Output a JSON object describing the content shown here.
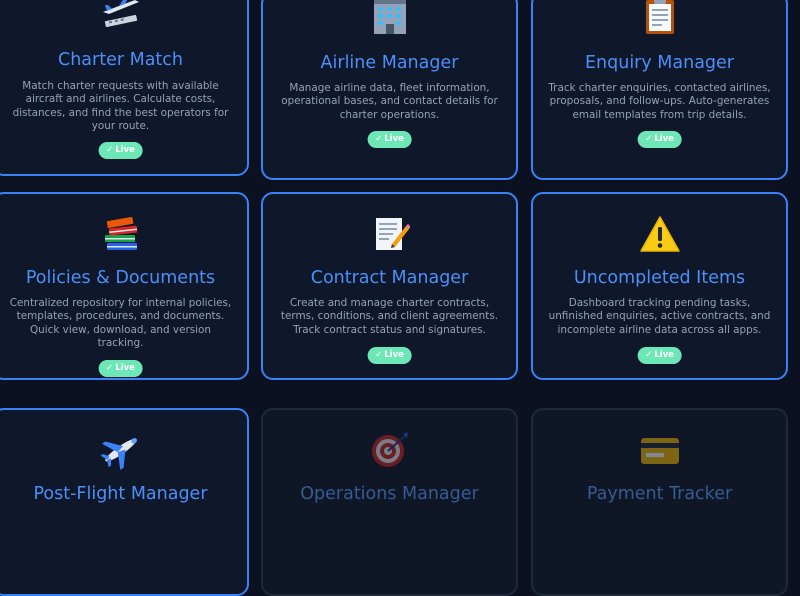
{
  "cards": [
    {
      "title": "Charter Match",
      "icon": "airplane-departure-icon",
      "description": "Match charter requests with available aircraft and airlines. Calculate costs, distances, and find the best operators for your route.",
      "status": "Live"
    },
    {
      "title": "Airline Manager",
      "icon": "office-building-icon",
      "description": "Manage airline data, fleet information, operational bases, and contact details for charter operations.",
      "status": "Live"
    },
    {
      "title": "Enquiry Manager",
      "icon": "clipboard-icon",
      "description": "Track charter enquiries, contacted airlines, proposals, and follow-ups. Auto-generates email templates from trip details.",
      "status": "Live"
    },
    {
      "title": "Policies & Documents",
      "icon": "books-icon",
      "description": "Centralized repository for internal policies, templates, procedures, and documents. Quick view, download, and version tracking.",
      "status": "Live"
    },
    {
      "title": "Contract Manager",
      "icon": "memo-icon",
      "description": "Create and manage charter contracts, terms, conditions, and client agreements. Track contract status and signatures.",
      "status": "Live"
    },
    {
      "title": "Uncompleted Items",
      "icon": "warning-icon",
      "description": "Dashboard tracking pending tasks, unfinished enquiries, active contracts, and incomplete airline data across all apps.",
      "status": "Live"
    },
    {
      "title": "Post-Flight Manager",
      "icon": "airplane-icon",
      "description": "",
      "status": ""
    },
    {
      "title": "Operations Manager",
      "icon": "target-icon",
      "description": "",
      "status": ""
    },
    {
      "title": "Payment Tracker",
      "icon": "credit-card-icon",
      "description": "",
      "status": ""
    }
  ],
  "colors": {
    "background": "#0b1120",
    "card": "#0f172a",
    "border": "#3b82f6",
    "title": "#4e8ff7",
    "badge": "#6ee7b7"
  }
}
